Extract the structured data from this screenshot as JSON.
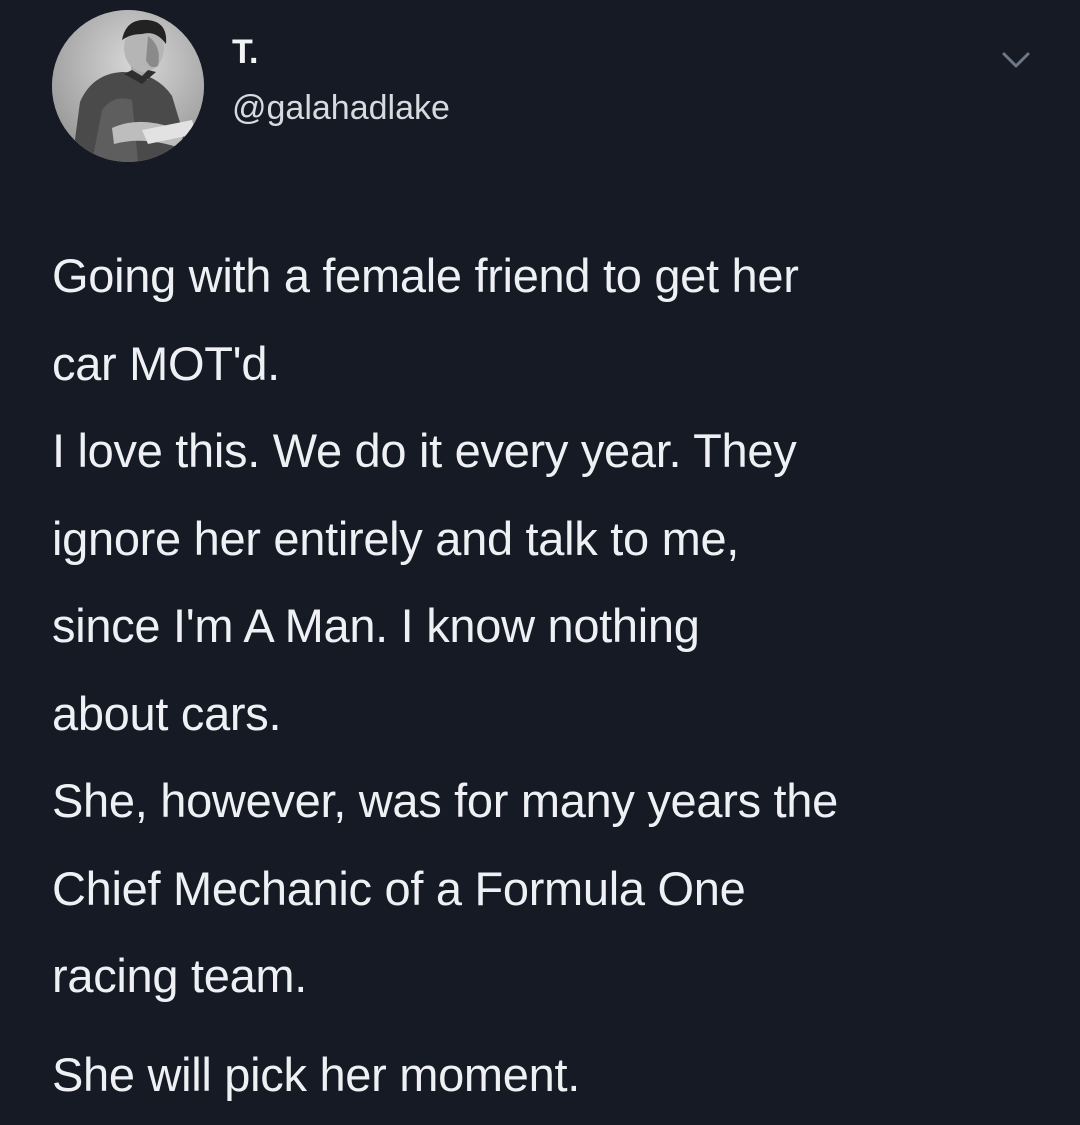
{
  "author": {
    "display_name": "T.",
    "handle": "@galahadlake"
  },
  "icons": {
    "avatar": "avatar-photo",
    "menu": "chevron-down-icon"
  },
  "tweet_lines": [
    "Going with a female friend to get her",
    "car MOT'd.",
    "I love this. We do it every year. They",
    "ignore her entirely and talk to me,",
    "since I'm A Man. I know nothing",
    "about cars.",
    "She, however, was for many years the",
    "Chief Mechanic of a Formula One",
    "racing team."
  ],
  "tweet_last_line": "She will pick her moment.",
  "colors": {
    "background": "#151a25",
    "text": "#eef0f3",
    "secondary_text": "#d7dadf",
    "chevron": "#6e7785"
  }
}
